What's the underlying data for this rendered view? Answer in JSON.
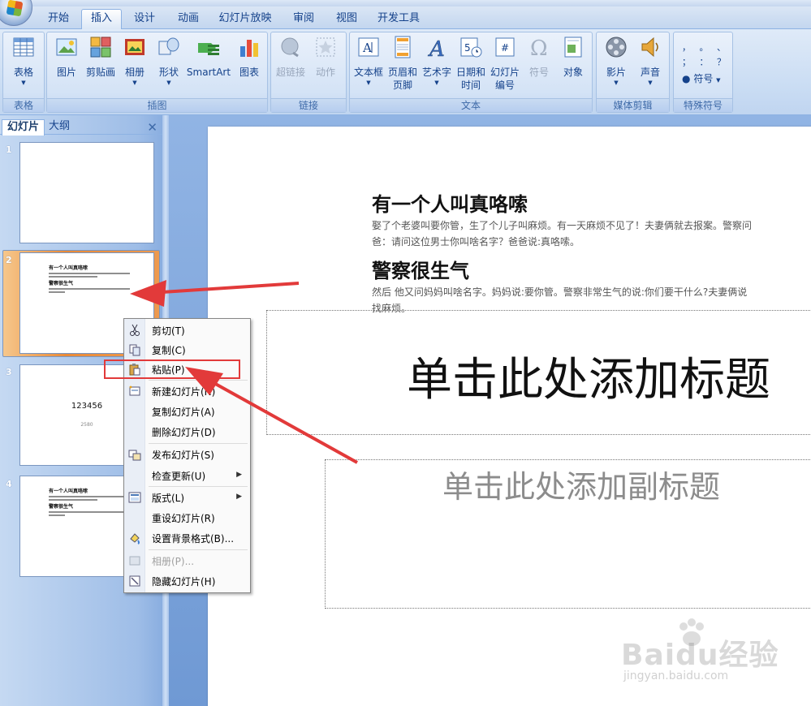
{
  "tabs": [
    "开始",
    "插入",
    "设计",
    "动画",
    "幻灯片放映",
    "审阅",
    "视图",
    "开发工具"
  ],
  "active_tab": "插入",
  "ribbon": {
    "groups": {
      "table": "表格",
      "illustrations": "插图",
      "links": "链接",
      "text": "文本",
      "media": "媒体剪辑",
      "symbols": "特殊符号"
    },
    "buttons": {
      "table": "表格",
      "picture": "图片",
      "clipart": "剪贴画",
      "album": "相册",
      "shapes": "形状",
      "smartart": "SmartArt",
      "chart": "图表",
      "hyperlink": "超链接",
      "action": "动作",
      "textbox": "文本框",
      "header_footer_1": "页眉和",
      "header_footer_2": "页脚",
      "wordart": "艺术字",
      "datetime_1": "日期和",
      "datetime_2": "时间",
      "slide_number_1": "幻灯片",
      "slide_number_2": "编号",
      "symbol": "符号",
      "object": "对象",
      "movie": "影片",
      "sound": "声音",
      "special_symbol": "符号",
      "punct_row1": "，   。   、",
      "punct_row2": "；   ：   ？"
    }
  },
  "panel": {
    "tab_slides": "幻灯片",
    "tab_outline": "大纲",
    "close": "✕",
    "slides": [
      {
        "num": "1"
      },
      {
        "num": "2"
      },
      {
        "num": "3",
        "text1": "123456",
        "text2": "2580"
      },
      {
        "num": "4"
      }
    ]
  },
  "slide": {
    "heading1": "有一个人叫真咯嗦",
    "para1_line1": "娶了个老婆叫要你管，生了个儿子叫麻烦。有一天麻烦不见了！夫妻俩就去报案。警察问",
    "para1_line2": "爸：请问这位男士你叫啥名字？爸爸说:真咯嗦。",
    "heading2": "警察很生气",
    "para2_line1": "然后 他又问妈妈叫啥名字。妈妈说:要你管。警察非常生气的说:你们要干什么?夫妻俩说",
    "para2_line2": "找麻烦。",
    "title_placeholder": "单击此处添加标题",
    "subtitle_placeholder": "单击此处添加副标题"
  },
  "context_menu": {
    "cut": "剪切(T)",
    "copy": "复制(C)",
    "paste": "粘贴(P)",
    "new_slide": "新建幻灯片(N)",
    "duplicate_slide": "复制幻灯片(A)",
    "delete_slide": "删除幻灯片(D)",
    "publish_slides": "发布幻灯片(S)",
    "check_updates": "检查更新(U)",
    "layout": "版式(L)",
    "reset_slide": "重设幻灯片(R)",
    "format_background": "设置背景格式(B)...",
    "photo_album": "相册(P)...",
    "hide_slide": "隐藏幻灯片(H)"
  },
  "watermark": {
    "brand": "Baidu经验",
    "url": "jingyan.baidu.com"
  },
  "colors": {
    "annotation_red": "#e23a3a",
    "selected_thumb": "#e98a37",
    "ribbon_text": "#15428b"
  }
}
